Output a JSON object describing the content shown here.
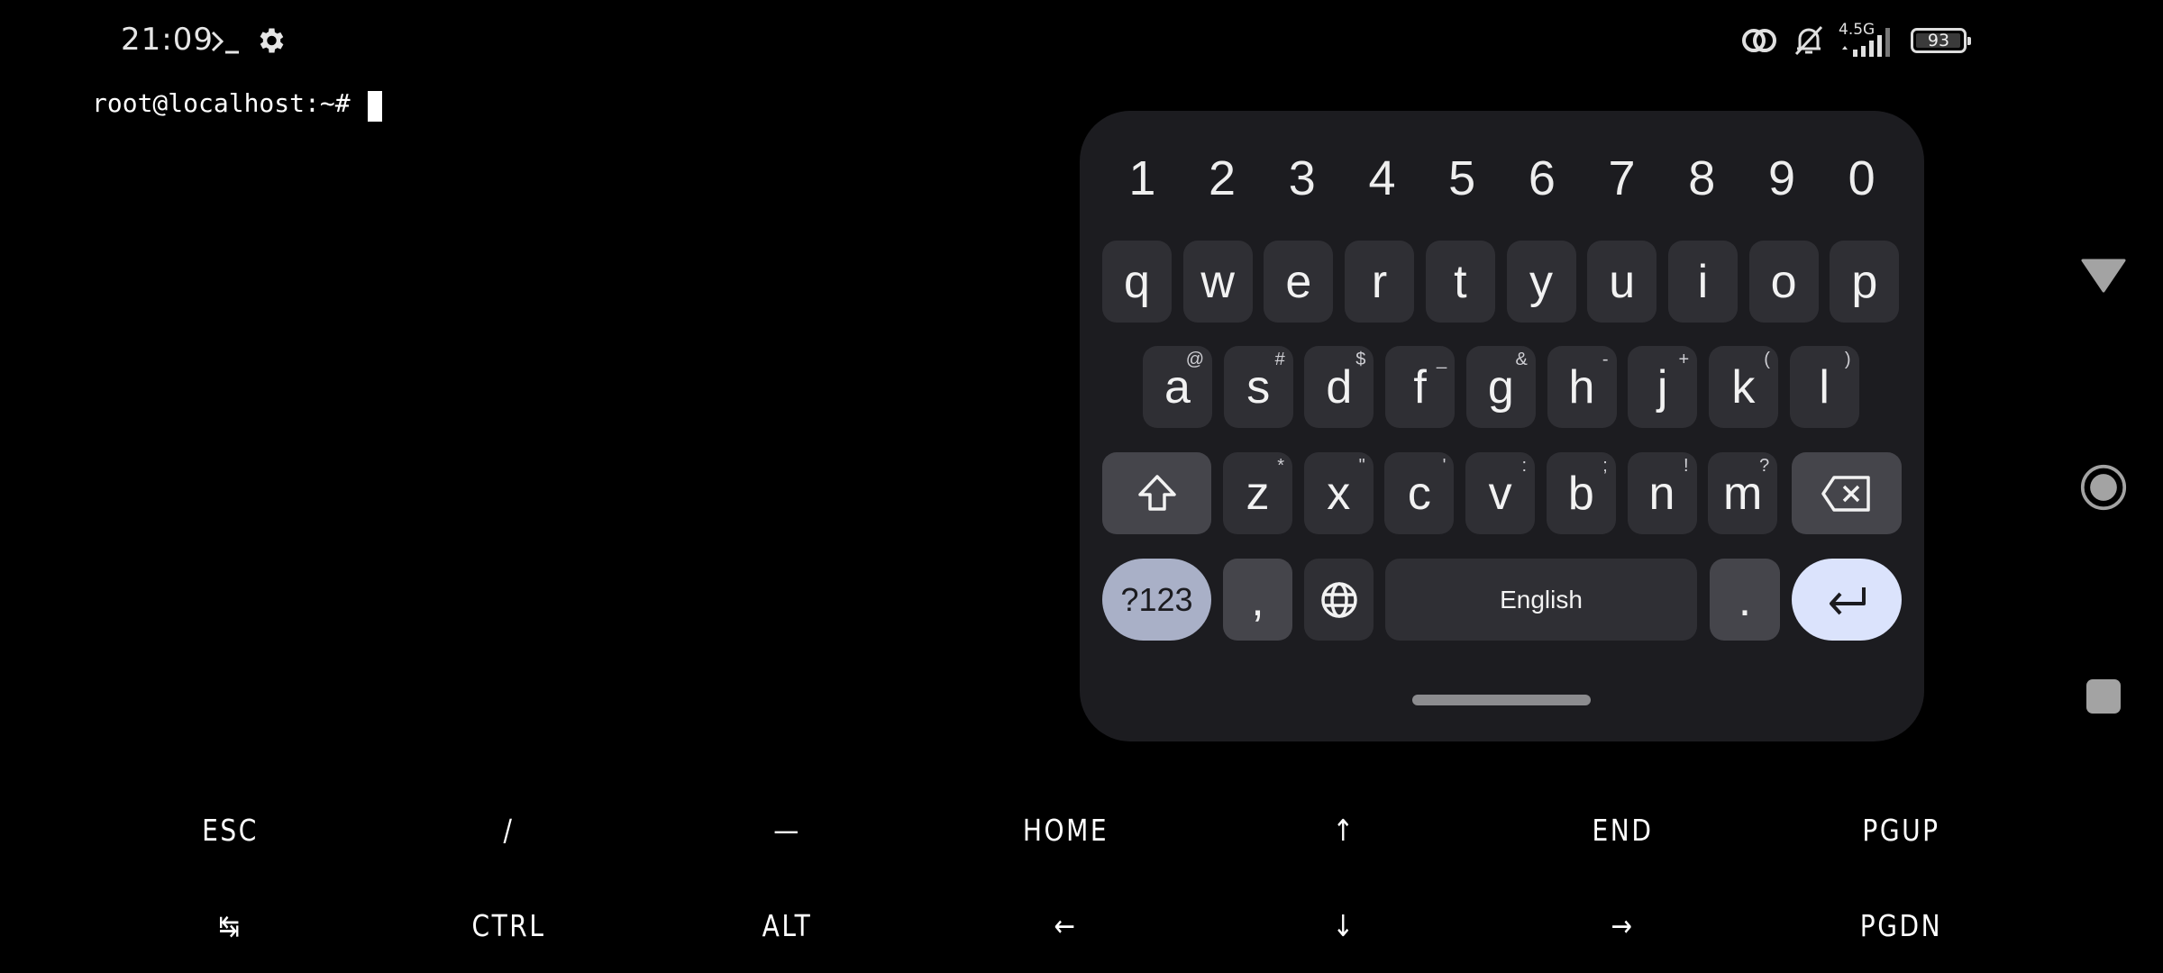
{
  "status_bar": {
    "time": "21:09",
    "left_icons": [
      "terminal-icon",
      "gear-icon"
    ],
    "right_icons": [
      "link-icon",
      "bell-off-icon",
      "signal-icon"
    ],
    "network_type": "4.5G",
    "battery_level": "93"
  },
  "terminal": {
    "prompt": "root@localhost:~# ",
    "input": ""
  },
  "keyboard": {
    "number_row": [
      "1",
      "2",
      "3",
      "4",
      "5",
      "6",
      "7",
      "8",
      "9",
      "0"
    ],
    "row1": [
      {
        "key": "q"
      },
      {
        "key": "w"
      },
      {
        "key": "e"
      },
      {
        "key": "r"
      },
      {
        "key": "t"
      },
      {
        "key": "y"
      },
      {
        "key": "u"
      },
      {
        "key": "i"
      },
      {
        "key": "o"
      },
      {
        "key": "p"
      }
    ],
    "row2": [
      {
        "key": "a",
        "alt": "@"
      },
      {
        "key": "s",
        "alt": "#"
      },
      {
        "key": "d",
        "alt": "$"
      },
      {
        "key": "f",
        "alt": "_"
      },
      {
        "key": "g",
        "alt": "&"
      },
      {
        "key": "h",
        "alt": "-"
      },
      {
        "key": "j",
        "alt": "+"
      },
      {
        "key": "k",
        "alt": "("
      },
      {
        "key": "l",
        "alt": ")"
      }
    ],
    "row3": [
      {
        "key": "z",
        "alt": "*"
      },
      {
        "key": "x",
        "alt": "\""
      },
      {
        "key": "c",
        "alt": "'"
      },
      {
        "key": "v",
        "alt": ":"
      },
      {
        "key": "b",
        "alt": ";"
      },
      {
        "key": "n",
        "alt": "!"
      },
      {
        "key": "m",
        "alt": "?"
      }
    ],
    "bottom_row": {
      "mode_label": "?123",
      "comma": ",",
      "space_label": "English",
      "period": "."
    },
    "colors": {
      "panel": "#1c1c20",
      "key": "#2f2f34",
      "key_function": "#45454b",
      "mode_key": "#a9b0c7",
      "enter_key": "#dbe3fc"
    }
  },
  "extra_keys": {
    "row1": [
      "ESC",
      "/",
      "—",
      "HOME",
      "↑",
      "END",
      "PGUP"
    ],
    "row2": [
      "↹",
      "CTRL",
      "ALT",
      "←",
      "↓",
      "→",
      "PGDN"
    ]
  },
  "nav_bar": [
    "back-icon",
    "home-icon",
    "recents-icon"
  ]
}
